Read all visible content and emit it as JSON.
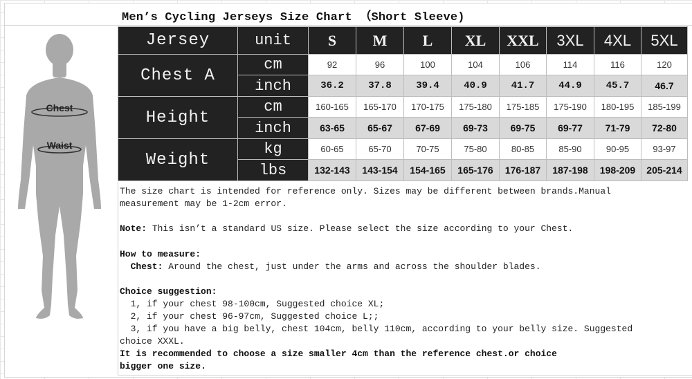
{
  "title": "Men’s Cycling Jerseys Size Chart （Short Sleeve)",
  "figure": {
    "chest_label": "Chest",
    "waist_label": "Waist"
  },
  "table": {
    "header": {
      "jersey": "Jersey",
      "unit": "unit",
      "sizes": [
        "S",
        "M",
        "L",
        "XL",
        "XXL",
        "3XL",
        "4XL",
        "5XL"
      ]
    },
    "groups": [
      {
        "label": "Chest A",
        "rows": [
          {
            "unit": "cm",
            "values": [
              "92",
              "96",
              "100",
              "104",
              "106",
              "114",
              "116",
              "120"
            ]
          },
          {
            "unit": "inch",
            "values": [
              "36.2",
              "37.8",
              "39.4",
              "40.9",
              "41.7",
              "44.9",
              "45.7",
              "46.7"
            ]
          }
        ]
      },
      {
        "label": "Height",
        "rows": [
          {
            "unit": "cm",
            "values": [
              "160-165",
              "165-170",
              "170-175",
              "175-180",
              "175-185",
              "175-190",
              "180-195",
              "185-199"
            ]
          },
          {
            "unit": "inch",
            "values": [
              "63-65",
              "65-67",
              "67-69",
              "69-73",
              "69-75",
              "69-77",
              "71-79",
              "72-80"
            ]
          }
        ]
      },
      {
        "label": "Weight",
        "rows": [
          {
            "unit": "kg",
            "values": [
              "60-65",
              "65-70",
              "70-75",
              "75-80",
              "80-85",
              "85-90",
              "90-95",
              "93-97"
            ]
          },
          {
            "unit": "lbs",
            "values": [
              "132-143",
              "143-154",
              "154-165",
              "165-176",
              "176-187",
              "187-198",
              "198-209",
              "205-214"
            ]
          }
        ]
      }
    ]
  },
  "notes": {
    "disclaimer_line1": "The size chart is intended for reference only. Sizes may be different between brands.Manual",
    "disclaimer_line2": "measurement may be 1-2cm error.",
    "note_label": "Note:",
    "note_text": " This isn’t a standard US size. Please select the size according to your Chest.",
    "how_label": "How to measure:",
    "chest_label": "  Chest:",
    "chest_text": " Around the chest, just under the arms and across the shoulder blades.",
    "choice_label": "Choice suggestion:",
    "choice_1": "  1, if your chest 98-100cm, Suggested choice XL;",
    "choice_2": "  2, if your chest 96-97cm, Suggested choice L;;",
    "choice_3a": "  3, if you have a big belly, chest 104cm, belly 110cm, according to your belly size. Suggested",
    "choice_3b": "choice XXXL.",
    "recommend_1": "It is recommended to choose a size smaller 4cm than the reference chest.or choice",
    "recommend_2": "bigger one size."
  }
}
